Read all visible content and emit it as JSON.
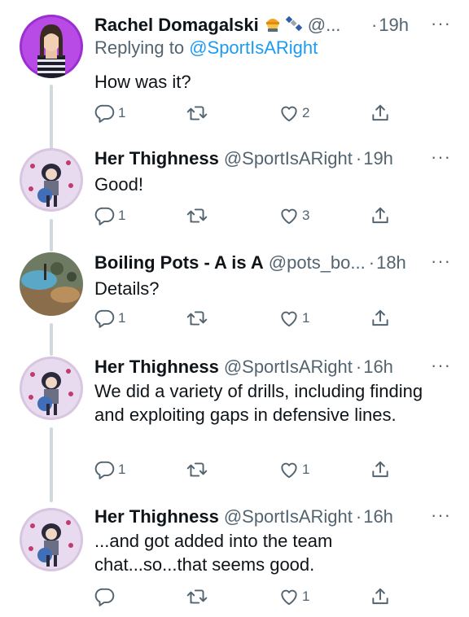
{
  "tweets": [
    {
      "name": "Rachel Domagalski",
      "handle": "@...",
      "dot": "·",
      "time": "19h",
      "replying_prefix": "Replying to ",
      "replying_handle": "@SportIsARight",
      "text": "How was it?",
      "reply_count": "1",
      "retweet_count": "",
      "like_count": "2",
      "more": "···"
    },
    {
      "name": "Her Thighness",
      "handle": "@SportIsARight",
      "dot": "·",
      "time": "19h",
      "text": "Good!",
      "reply_count": "1",
      "retweet_count": "",
      "like_count": "3",
      "more": "···"
    },
    {
      "name": "Boiling Pots - A is A",
      "handle": "@pots_bo...",
      "dot": "·",
      "time": "18h",
      "text": "Details?",
      "reply_count": "1",
      "retweet_count": "",
      "like_count": "1",
      "more": "···"
    },
    {
      "name": "Her Thighness",
      "handle": "@SportIsARight",
      "dot": "·",
      "time": "16h",
      "text": "We did a variety of drills, including finding and exploiting gaps in defensive lines.",
      "reply_count": "1",
      "retweet_count": "",
      "like_count": "1",
      "more": "···"
    },
    {
      "name": "Her Thighness",
      "handle": "@SportIsARight",
      "dot": "·",
      "time": "16h",
      "text": "...and got added into the team chat...so...that seems good.",
      "reply_count": "",
      "retweet_count": "",
      "like_count": "1",
      "more": "···"
    }
  ],
  "colors": {
    "text": "#0f1419",
    "secondary": "#536471",
    "link": "#1d9bf0",
    "thread_line": "#cfd9de"
  },
  "icons": [
    "reply-icon",
    "retweet-icon",
    "like-icon",
    "share-icon",
    "more-icon"
  ]
}
